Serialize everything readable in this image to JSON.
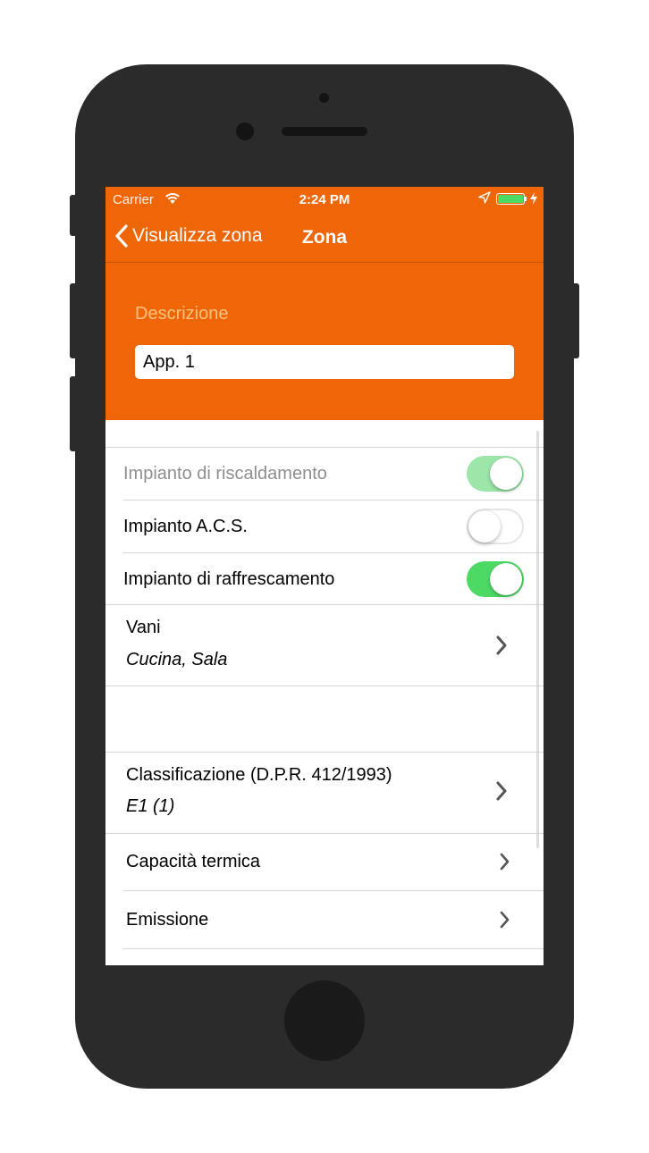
{
  "status": {
    "carrier": "Carrier",
    "time": "2:24 PM"
  },
  "nav": {
    "back_label": "Visualizza zona",
    "title": "Zona"
  },
  "descrizione": {
    "label": "Descrizione",
    "value": "App. 1"
  },
  "toggles": [
    {
      "label": "Impianto di riscaldamento",
      "on": true,
      "disabled": true
    },
    {
      "label": "Impianto A.C.S.",
      "on": false,
      "disabled": false
    },
    {
      "label": "Impianto di raffrescamento",
      "on": true,
      "disabled": false
    }
  ],
  "vani": {
    "title": "Vani",
    "value": "Cucina, Sala"
  },
  "classificazione": {
    "title": "Classificazione (D.P.R. 412/1993)",
    "value": "E1 (1)"
  },
  "menu": {
    "capacita": "Capacità termica",
    "emissione": "Emissione"
  },
  "colors": {
    "accent": "#ef6608",
    "switch_on": "#4cd964",
    "switch_on_disabled": "#9be6a8"
  }
}
